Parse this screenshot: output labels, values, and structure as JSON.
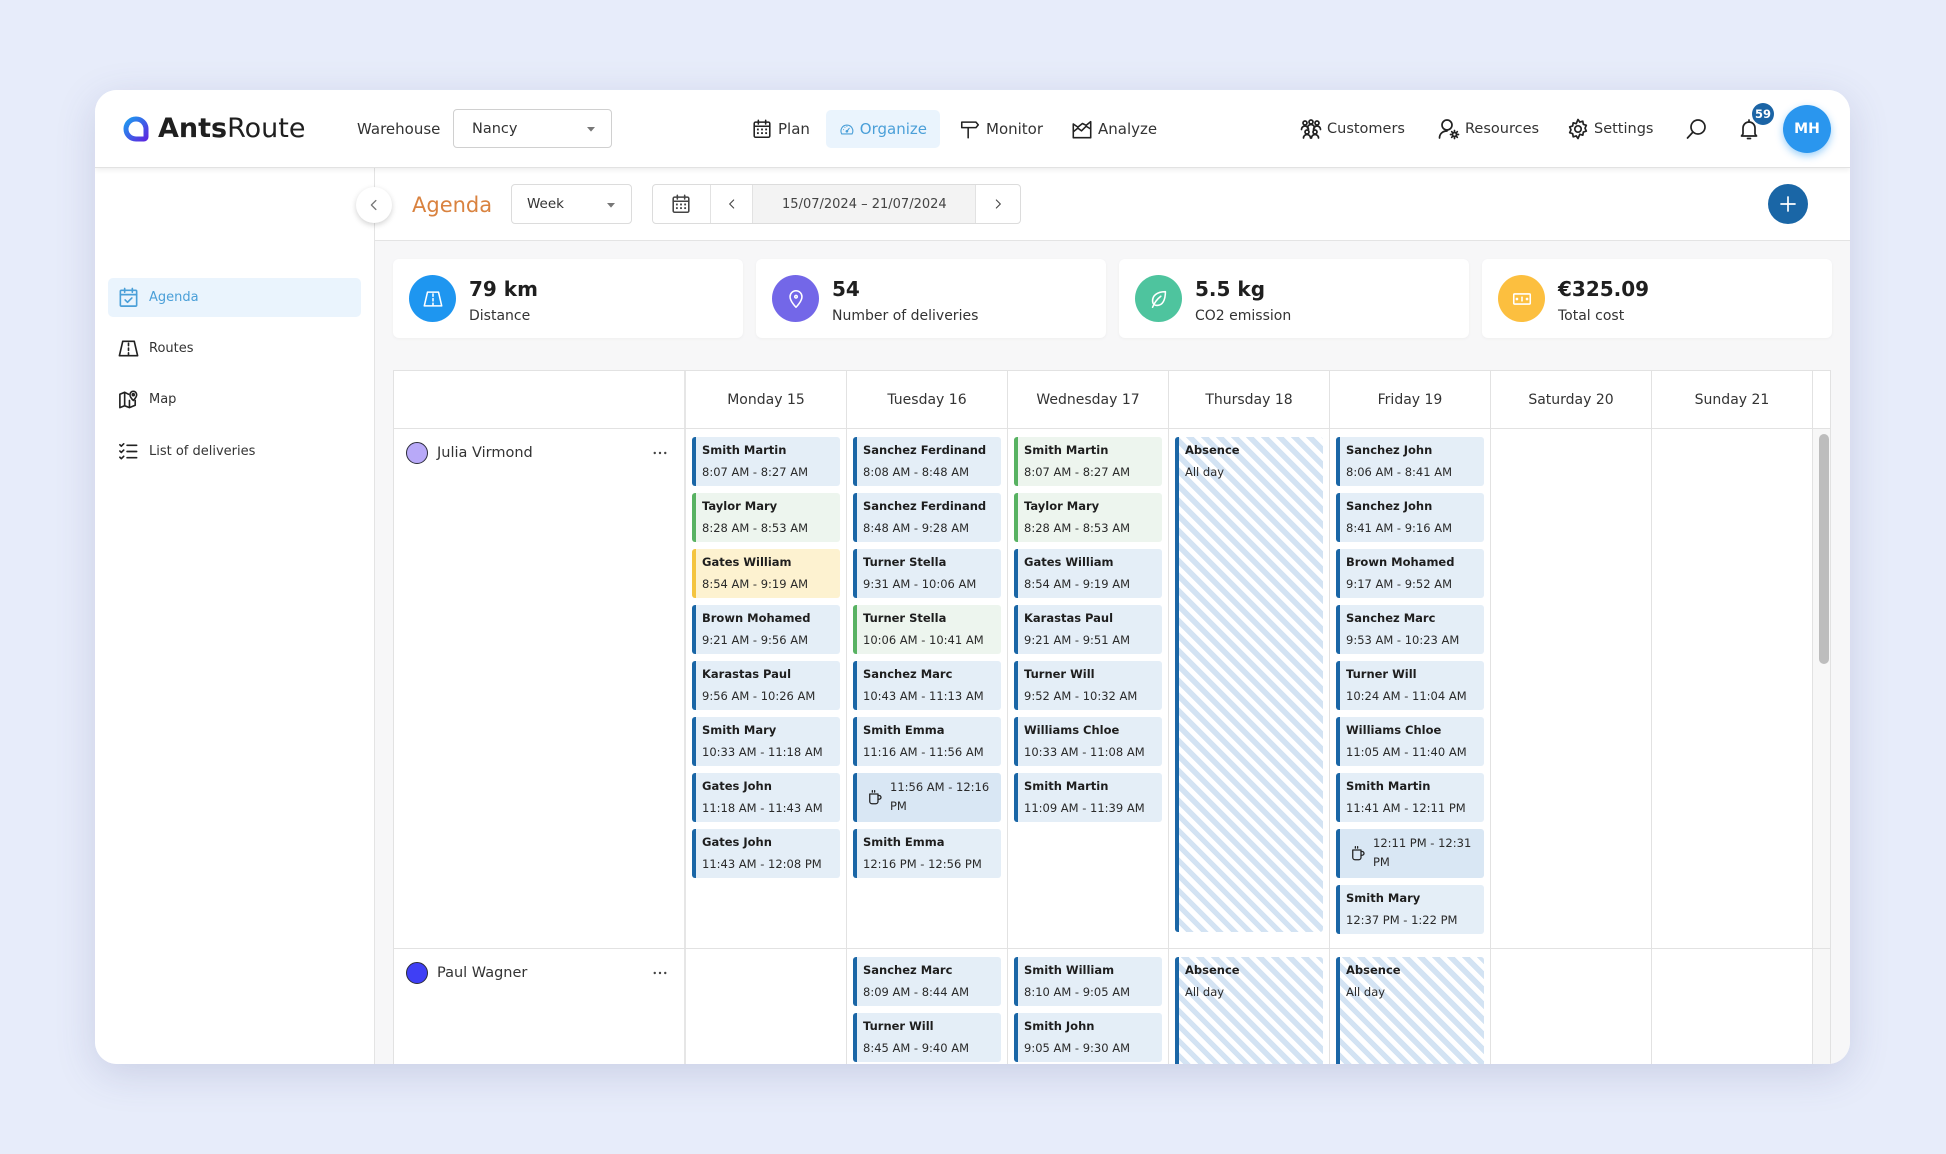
{
  "app": {
    "name_bold": "Ants",
    "name_regular": "Route",
    "logo_icon": "logo-icon"
  },
  "header": {
    "warehouse": {
      "label": "Warehouse",
      "value": "Nancy"
    },
    "nav": [
      {
        "label": "Plan",
        "icon": "calendar-grid-icon",
        "active": false
      },
      {
        "label": "Organize",
        "icon": "speedometer-icon",
        "active": true
      },
      {
        "label": "Monitor",
        "icon": "signpost-icon",
        "active": false
      },
      {
        "label": "Analyze",
        "icon": "chart-area-icon",
        "active": false
      }
    ],
    "secondary_nav": [
      {
        "label": "Customers",
        "icon": "users-group-icon"
      },
      {
        "label": "Resources",
        "icon": "user-gear-icon"
      },
      {
        "label": "Settings",
        "icon": "gear-icon"
      }
    ],
    "search_icon": "search-icon",
    "notifications": {
      "icon": "bell-icon",
      "count": "59"
    },
    "user": {
      "initials": "MH"
    }
  },
  "sidebar": {
    "items": [
      {
        "label": "Agenda",
        "icon": "calendar-check-icon",
        "active": true
      },
      {
        "label": "Routes",
        "icon": "road-icon",
        "active": false
      },
      {
        "label": "Map",
        "icon": "map-pin-icon",
        "active": false
      },
      {
        "label": "List of deliveries",
        "icon": "checklist-icon",
        "active": false
      }
    ]
  },
  "toolbar": {
    "title": "Agenda",
    "view": {
      "value": "Week"
    },
    "date_range": "15/07/2024 – 21/07/2024"
  },
  "stats": [
    {
      "value": "79 km",
      "label": "Distance",
      "icon": "road-icon",
      "color": "#1e96f0"
    },
    {
      "value": "54",
      "label": "Number of deliveries",
      "icon": "location-pin-icon",
      "color": "#7367e8"
    },
    {
      "value": "5.5 kg",
      "label": "CO2 emission",
      "icon": "leaf-icon",
      "color": "#4ec49e"
    },
    {
      "value": "€325.09",
      "label": "Total cost",
      "icon": "banknote-icon",
      "color": "#fcbf3f"
    }
  ],
  "agenda": {
    "days": [
      "Monday 15",
      "Tuesday 16",
      "Wednesday 17",
      "Thursday 18",
      "Friday 19",
      "Saturday 20",
      "Sunday 21"
    ],
    "resources": [
      {
        "name": "Julia Virmond",
        "color": "#b8a9f8",
        "days": [
          [
            {
              "type": "delivery",
              "title": "Smith Martin",
              "time": "8:07 AM - 8:27 AM",
              "accent": "blue"
            },
            {
              "type": "delivery",
              "title": "Taylor Mary",
              "time": "8:28 AM - 8:53 AM",
              "accent": "green"
            },
            {
              "type": "delivery",
              "title": "Gates William",
              "time": "8:54 AM - 9:19 AM",
              "accent": "yellow"
            },
            {
              "type": "delivery",
              "title": "Brown Mohamed",
              "time": "9:21 AM - 9:56 AM",
              "accent": "blue"
            },
            {
              "type": "delivery",
              "title": "Karastas Paul",
              "time": "9:56 AM - 10:26 AM",
              "accent": "blue"
            },
            {
              "type": "delivery",
              "title": "Smith Mary",
              "time": "10:33 AM - 11:18 AM",
              "accent": "blue"
            },
            {
              "type": "delivery",
              "title": "Gates John",
              "time": "11:18 AM - 11:43 AM",
              "accent": "blue"
            },
            {
              "type": "delivery",
              "title": "Gates John",
              "time": "11:43 AM - 12:08 PM",
              "accent": "blue"
            }
          ],
          [
            {
              "type": "delivery",
              "title": "Sanchez Ferdinand",
              "time": "8:08 AM - 8:48 AM",
              "accent": "blue"
            },
            {
              "type": "delivery",
              "title": "Sanchez Ferdinand",
              "time": "8:48 AM - 9:28 AM",
              "accent": "blue"
            },
            {
              "type": "delivery",
              "title": "Turner Stella",
              "time": "9:31 AM - 10:06 AM",
              "accent": "blue"
            },
            {
              "type": "delivery",
              "title": "Turner Stella",
              "time": "10:06 AM - 10:41 AM",
              "accent": "green"
            },
            {
              "type": "delivery",
              "title": "Sanchez Marc",
              "time": "10:43 AM - 11:13 AM",
              "accent": "blue"
            },
            {
              "type": "delivery",
              "title": "Smith Emma",
              "time": "11:16 AM - 11:56 AM",
              "accent": "blue"
            },
            {
              "type": "break",
              "icon": "coffee-cup-icon",
              "time": "11:56 AM - 12:16 PM"
            },
            {
              "type": "delivery",
              "title": "Smith Emma",
              "time": "12:16 PM - 12:56 PM",
              "accent": "blue"
            }
          ],
          [
            {
              "type": "delivery",
              "title": "Smith Martin",
              "time": "8:07 AM - 8:27 AM",
              "accent": "green"
            },
            {
              "type": "delivery",
              "title": "Taylor Mary",
              "time": "8:28 AM - 8:53 AM",
              "accent": "green"
            },
            {
              "type": "delivery",
              "title": "Gates William",
              "time": "8:54 AM - 9:19 AM",
              "accent": "blue"
            },
            {
              "type": "delivery",
              "title": "Karastas Paul",
              "time": "9:21 AM - 9:51 AM",
              "accent": "blue"
            },
            {
              "type": "delivery",
              "title": "Turner Will",
              "time": "9:52 AM - 10:32 AM",
              "accent": "blue"
            },
            {
              "type": "delivery",
              "title": "Williams Chloe",
              "time": "10:33 AM - 11:08 AM",
              "accent": "blue"
            },
            {
              "type": "delivery",
              "title": "Smith Martin",
              "time": "11:09 AM - 11:39 AM",
              "accent": "blue"
            }
          ],
          [
            {
              "type": "absence",
              "title": "Absence",
              "time": "All day"
            }
          ],
          [
            {
              "type": "delivery",
              "title": "Sanchez John",
              "time": "8:06 AM - 8:41 AM",
              "accent": "blue"
            },
            {
              "type": "delivery",
              "title": "Sanchez John",
              "time": "8:41 AM - 9:16 AM",
              "accent": "blue"
            },
            {
              "type": "delivery",
              "title": "Brown Mohamed",
              "time": "9:17 AM - 9:52 AM",
              "accent": "blue"
            },
            {
              "type": "delivery",
              "title": "Sanchez Marc",
              "time": "9:53 AM - 10:23 AM",
              "accent": "blue"
            },
            {
              "type": "delivery",
              "title": "Turner Will",
              "time": "10:24 AM - 11:04 AM",
              "accent": "blue"
            },
            {
              "type": "delivery",
              "title": "Williams Chloe",
              "time": "11:05 AM - 11:40 AM",
              "accent": "blue"
            },
            {
              "type": "delivery",
              "title": "Smith Martin",
              "time": "11:41 AM - 12:11 PM",
              "accent": "blue"
            },
            {
              "type": "break",
              "icon": "coffee-cup-icon",
              "time": "12:11 PM - 12:31 PM"
            },
            {
              "type": "delivery",
              "title": "Smith Mary",
              "time": "12:37 PM - 1:22 PM",
              "accent": "blue"
            }
          ],
          [],
          []
        ]
      },
      {
        "name": "Paul Wagner",
        "color": "#3f3ff5",
        "days": [
          [],
          [
            {
              "type": "delivery",
              "title": "Sanchez Marc",
              "time": "8:09 AM - 8:44 AM",
              "accent": "blue"
            },
            {
              "type": "delivery",
              "title": "Turner Will",
              "time": "8:45 AM - 9:40 AM",
              "accent": "blue"
            }
          ],
          [
            {
              "type": "delivery",
              "title": "Smith William",
              "time": "8:10 AM - 9:05 AM",
              "accent": "blue"
            },
            {
              "type": "delivery",
              "title": "Smith John",
              "time": "9:05 AM - 9:30 AM",
              "accent": "blue"
            }
          ],
          [
            {
              "type": "absence",
              "title": "Absence",
              "time": "All day"
            }
          ],
          [
            {
              "type": "absence",
              "title": "Absence",
              "time": "All day"
            }
          ],
          [],
          []
        ]
      }
    ]
  },
  "colors": {
    "accent": "#4a9fd8",
    "primary_dark": "#1a66a6",
    "title_orange": "#d9823f",
    "event_accents": {
      "blue": {
        "border": "#1a66a6",
        "bg": "#e4eef7"
      },
      "green": {
        "border": "#58b262",
        "bg": "#edf5ee"
      },
      "yellow": {
        "border": "#f4c43f",
        "bg": "#fdf2d0"
      }
    }
  }
}
